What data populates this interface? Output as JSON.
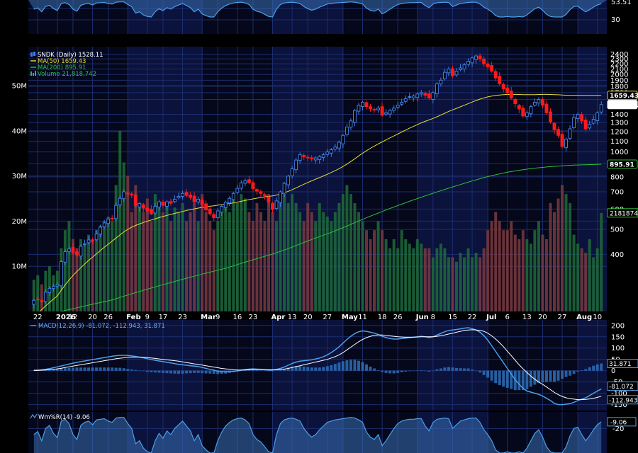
{
  "chart_data": {
    "type": "candlestick",
    "symbol": "SNDK (Daily)",
    "last_price": "1528.11",
    "colors": {
      "up": "#3f7fe8",
      "down": "#ff1a1a",
      "ma50": "#e6dc3a",
      "ma200": "#2dbd3a",
      "volume_up": "#1f6a3a",
      "volume_down": "#7a3a40",
      "grid": "#1c2e6e",
      "macd": "#4a9fe8",
      "signal": "#ffffff",
      "willr": "#4a9fe8"
    },
    "legend": [
      {
        "icon": "candle-icon",
        "text": "SNDK (Daily) 1528.11",
        "color": "#ffffff"
      },
      {
        "icon": "line-icon",
        "text": "MA(50) 1659.43",
        "color": "#e6dc3a"
      },
      {
        "icon": "line-icon",
        "text": "MA(200) 895.91",
        "color": "#2dbd3a"
      },
      {
        "icon": "bar-icon",
        "text": "Volume 21,818,742",
        "color": "#2dbd3a"
      }
    ],
    "x_ticks": [
      "22",
      "2026",
      "12",
      "20",
      "26",
      "Feb",
      "9",
      "17",
      "23",
      "Mar",
      "9",
      "16",
      "23",
      "Apr",
      "13",
      "20",
      "27",
      "May",
      "11",
      "18",
      "26",
      "Jun",
      "8",
      "15",
      "22",
      "Jul",
      "6",
      "13",
      "20",
      "27",
      "Aug",
      "10"
    ],
    "price_axis": {
      "scale": "log",
      "ylim": [
        240,
        2500
      ],
      "ticks": [
        "2400",
        "2300",
        "2200",
        "2100",
        "2000",
        "1900",
        "1800",
        "1700",
        "1600",
        "1400",
        "1300",
        "1200",
        "1100",
        "1000",
        "900",
        "800",
        "700",
        "600",
        "500",
        "400"
      ],
      "tick_values": [
        2400,
        2300,
        2200,
        2100,
        2000,
        1900,
        1800,
        1700,
        1600,
        1400,
        1300,
        1200,
        1100,
        1000,
        900,
        800,
        700,
        600,
        500,
        400
      ],
      "tags": [
        {
          "text": "1659.43",
          "value": 1659.43,
          "fill": "#000000",
          "color": "#ffffff",
          "stroke": "#e6dc3a"
        },
        {
          "text": "1528.11",
          "value": 1528.11,
          "fill": "#ffffff",
          "color": "#000000",
          "stroke": "#ffffff"
        },
        {
          "text": "895.91",
          "value": 895.91,
          "fill": "#000000",
          "color": "#ffffff",
          "stroke": "#2dbd3a"
        }
      ]
    },
    "volume_axis": {
      "ylim": [
        0,
        58000000
      ],
      "ticks": [
        "50M",
        "40M",
        "30M",
        "20M",
        "10M"
      ],
      "tick_values": [
        50000000,
        40000000,
        30000000,
        20000000,
        10000000
      ],
      "tag": {
        "text": "21818742",
        "value": 21818742
      }
    },
    "top_panel": {
      "ticks": [
        "53.51",
        "30"
      ]
    },
    "macd": {
      "label": "MACD(12,26,9) -81.072, -112.943, 31.871",
      "ylim": [
        -170,
        215
      ],
      "ticks": [
        "200",
        "150",
        "100",
        "50",
        "0",
        "-50",
        "-100",
        "-150"
      ],
      "tick_values": [
        200,
        150,
        100,
        50,
        0,
        -50,
        -100,
        -150
      ],
      "tags": [
        {
          "text": "31.871",
          "value": 31.871
        },
        {
          "text": "-81.072",
          "value": -81.072
        },
        {
          "text": "-112.943",
          "value": -112.943
        }
      ]
    },
    "willr": {
      "label": "Wm%R(14) -9.06",
      "ylim": [
        -60,
        0
      ],
      "ticks": [
        "-20"
      ],
      "tick_values": [
        -20
      ],
      "tag": {
        "text": "-9.06",
        "value": -9.06
      }
    },
    "closes": [
      265,
      268,
      262,
      285,
      295,
      300,
      305,
      375,
      410,
      420,
      405,
      398,
      430,
      440,
      455,
      450,
      480,
      510,
      530,
      548,
      550,
      620,
      660,
      700,
      690,
      680,
      620,
      630,
      605,
      590,
      575,
      615,
      640,
      620,
      640,
      632,
      655,
      672,
      690,
      678,
      665,
      640,
      655,
      625,
      595,
      575,
      555,
      590,
      615,
      638,
      660,
      690,
      722,
      758,
      772,
      760,
      720,
      705,
      690,
      675,
      640,
      598,
      645,
      700,
      755,
      805,
      860,
      930,
      975,
      958,
      948,
      940,
      948,
      960,
      975,
      1000,
      1020,
      1045,
      1090,
      1160,
      1250,
      1320,
      1450,
      1520,
      1560,
      1500,
      1470,
      1460,
      1480,
      1390,
      1420,
      1450,
      1480,
      1520,
      1560,
      1610,
      1640,
      1650,
      1680,
      1700,
      1660,
      1620,
      1700,
      1840,
      1900,
      2040,
      2100,
      1980,
      2060,
      2120,
      2180,
      2250,
      2320,
      2360,
      2300,
      2200,
      2140,
      2060,
      1940,
      1840,
      1760,
      1700,
      1620,
      1540,
      1470,
      1380,
      1420,
      1500,
      1560,
      1600,
      1520,
      1420,
      1310,
      1220,
      1160,
      1050,
      1120,
      1230,
      1360,
      1400,
      1320,
      1230,
      1280,
      1340,
      1420,
      1528
    ],
    "ma50": [
      228,
      236,
      244,
      252,
      260,
      268,
      276,
      290,
      304,
      318,
      331,
      343,
      355,
      367,
      379,
      390,
      402,
      414,
      426,
      438,
      450,
      463,
      476,
      489,
      500,
      510,
      518,
      525,
      532,
      538,
      544,
      550,
      556,
      561,
      567,
      572,
      577,
      582,
      587,
      592,
      597,
      601,
      605,
      609,
      612,
      615,
      618,
      621,
      624,
      627,
      630,
      634,
      638,
      643,
      648,
      653,
      657,
      661,
      665,
      669,
      672,
      675,
      680,
      686,
      694,
      703,
      713,
      725,
      737,
      749,
      761,
      772,
      784,
      795,
      807,
      819,
      832,
      846,
      861,
      878,
      897,
      918,
      941,
      965,
      989,
      1011,
      1033,
      1054,
      1075,
      1094,
      1114,
      1134,
      1154,
      1174,
      1195,
      1216,
      1237,
      1257,
      1277,
      1297,
      1315,
      1332,
      1350,
      1370,
      1391,
      1414,
      1437,
      1457,
      1477,
      1498,
      1519,
      1541,
      1563,
      1585,
      1605,
      1622,
      1637,
      1649,
      1658,
      1665,
      1669,
      1672,
      1673,
      1673,
      1672,
      1670,
      1669,
      1669,
      1670,
      1672,
      1673,
      1673,
      1672,
      1670,
      1668,
      1664,
      1662,
      1661,
      1661,
      1661,
      1660,
      1659,
      1659,
      1659,
      1659,
      1659
    ],
    "ma200": [
      232,
      233,
      234,
      235,
      236,
      237,
      238,
      240,
      242,
      244,
      246,
      248,
      250,
      252,
      254,
      256,
      258,
      260,
      262,
      264,
      266,
      269,
      272,
      275,
      278,
      281,
      284,
      287,
      290,
      293,
      296,
      299,
      302,
      305,
      308,
      311,
      314,
      317,
      320,
      323,
      326,
      329,
      332,
      335,
      338,
      341,
      344,
      347,
      350,
      353,
      357,
      361,
      365,
      369,
      373,
      377,
      381,
      385,
      389,
      393,
      397,
      401,
      406,
      411,
      416,
      421,
      427,
      433,
      439,
      445,
      451,
      457,
      463,
      469,
      475,
      481,
      487,
      494,
      501,
      508,
      515,
      523,
      531,
      539,
      547,
      555,
      563,
      571,
      579,
      587,
      595,
      603,
      611,
      619,
      627,
      635,
      643,
      651,
      659,
      667,
      675,
      683,
      691,
      699,
      707,
      715,
      723,
      731,
      739,
      747,
      755,
      763,
      771,
      779,
      787,
      795,
      802,
      809,
      816,
      822,
      828,
      834,
      839,
      844,
      849,
      853,
      857,
      861,
      865,
      868,
      871,
      874,
      877,
      879,
      881,
      883,
      885,
      887,
      889,
      890,
      891,
      892,
      893,
      894,
      895,
      896
    ],
    "macd_line": [
      2,
      3,
      4,
      6,
      9,
      13,
      17,
      21,
      25,
      29,
      33,
      37,
      40,
      43,
      46,
      49,
      52,
      55,
      58,
      61,
      64,
      66,
      68,
      68,
      67,
      65,
      63,
      60,
      57,
      53,
      49,
      46,
      43,
      40,
      37,
      34,
      31,
      28,
      26,
      24,
      22,
      20,
      18,
      14,
      10,
      6,
      2,
      -2,
      -4,
      -5,
      -4,
      -3,
      -1,
      2,
      5,
      7,
      8,
      7,
      6,
      4,
      2,
      2,
      6,
      10,
      16,
      24,
      32,
      38,
      42,
      44,
      46,
      48,
      52,
      56,
      62,
      70,
      80,
      92,
      106,
      122,
      138,
      152,
      164,
      172,
      176,
      174,
      170,
      166,
      160,
      152,
      146,
      142,
      140,
      140,
      142,
      144,
      146,
      148,
      150,
      152,
      150,
      146,
      150,
      158,
      165,
      172,
      178,
      180,
      182,
      185,
      188,
      190,
      186,
      180,
      170,
      155,
      135,
      110,
      85,
      60,
      35,
      10,
      -15,
      -40,
      -60,
      -78,
      -90,
      -95,
      -100,
      -105,
      -112,
      -122,
      -132,
      -145,
      -150,
      -150,
      -148,
      -146,
      -140,
      -132,
      -126,
      -120,
      -110,
      -100,
      -90,
      -81
    ],
    "signal_line": [
      1,
      1,
      2,
      3,
      4,
      6,
      8,
      11,
      14,
      17,
      20,
      23,
      26,
      29,
      32,
      35,
      38,
      41,
      44,
      47,
      50,
      53,
      55,
      57,
      59,
      60,
      60,
      60,
      59,
      58,
      56,
      54,
      52,
      50,
      48,
      46,
      44,
      42,
      39,
      36,
      33,
      30,
      28,
      25,
      22,
      19,
      16,
      13,
      10,
      8,
      6,
      4,
      3,
      3,
      3,
      4,
      5,
      5,
      5,
      5,
      4,
      4,
      4,
      5,
      7,
      10,
      14,
      18,
      22,
      26,
      30,
      34,
      38,
      42,
      46,
      50,
      56,
      62,
      70,
      80,
      92,
      104,
      116,
      128,
      138,
      146,
      152,
      156,
      158,
      158,
      156,
      154,
      152,
      150,
      149,
      148,
      148,
      148,
      149,
      150,
      150,
      150,
      150,
      152,
      155,
      158,
      162,
      166,
      170,
      174,
      178,
      180,
      181,
      180,
      178,
      174,
      166,
      154,
      140,
      124,
      106,
      86,
      66,
      46,
      26,
      8,
      -8,
      -24,
      -38,
      -50,
      -60,
      -72,
      -84,
      -96,
      -106,
      -114,
      -120,
      -124,
      -126,
      -128,
      -128,
      -127,
      -125,
      -122,
      -118,
      -113
    ],
    "willr_line": [
      -30,
      -25,
      -40,
      -20,
      -15,
      -28,
      -35,
      -8,
      -5,
      -12,
      -30,
      -38,
      -15,
      -10,
      -8,
      -14,
      -6,
      -5,
      -4,
      -8,
      -10,
      -3,
      -2,
      -2,
      -12,
      -20,
      -45,
      -40,
      -52,
      -58,
      -60,
      -40,
      -28,
      -36,
      -24,
      -30,
      -20,
      -14,
      -8,
      -16,
      -24,
      -40,
      -30,
      -48,
      -55,
      -60,
      -60,
      -40,
      -26,
      -16,
      -10,
      -6,
      -4,
      -3,
      -6,
      -12,
      -30,
      -38,
      -42,
      -50,
      -58,
      -60,
      -30,
      -12,
      -6,
      -4,
      -3,
      -5,
      -8,
      -20,
      -28,
      -34,
      -30,
      -22,
      -16,
      -10,
      -8,
      -6,
      -5,
      -4,
      -3,
      -2,
      -3,
      -6,
      -10,
      -26,
      -34,
      -38,
      -30,
      -48,
      -40,
      -30,
      -20,
      -12,
      -8,
      -6,
      -5,
      -5,
      -4,
      -4,
      -16,
      -24,
      -10,
      -5,
      -4,
      -3,
      -4,
      -20,
      -14,
      -8,
      -6,
      -4,
      -3,
      -3,
      -10,
      -22,
      -30,
      -40,
      -55,
      -60,
      -60,
      -58,
      -60,
      -60,
      -58,
      -60,
      -52,
      -40,
      -28,
      -22,
      -34,
      -50,
      -58,
      -60,
      -60,
      -60,
      -50,
      -32,
      -20,
      -18,
      -30,
      -40,
      -32,
      -22,
      -14,
      -9.06
    ],
    "volume": [
      7,
      8,
      6,
      9,
      10,
      8,
      9,
      14,
      18,
      20,
      16,
      14,
      16,
      15,
      17,
      16,
      18,
      19,
      20,
      21,
      20,
      28,
      40,
      33,
      30,
      22,
      28,
      24,
      22,
      25,
      20,
      26,
      23,
      22,
      24,
      20,
      23,
      22,
      24,
      20,
      22,
      24,
      20,
      26,
      22,
      20,
      18,
      20,
      22,
      24,
      22,
      25,
      24,
      26,
      25,
      22,
      20,
      24,
      22,
      20,
      26,
      22,
      20,
      24,
      26,
      24,
      26,
      24,
      22,
      20,
      24,
      22,
      20,
      24,
      22,
      21,
      20,
      22,
      24,
      26,
      28,
      26,
      24,
      22,
      20,
      18,
      16,
      18,
      20,
      18,
      16,
      14,
      16,
      14,
      18,
      16,
      15,
      14,
      16,
      15,
      14,
      14,
      12,
      14,
      15,
      14,
      12,
      12,
      11,
      13,
      12,
      14,
      12,
      13,
      12,
      14,
      18,
      20,
      22,
      20,
      18,
      18,
      20,
      17,
      16,
      18,
      16,
      15,
      18,
      20,
      17,
      16,
      24,
      22,
      25,
      28,
      26,
      24,
      17,
      15,
      14,
      13,
      16,
      12,
      14,
      21.8
    ]
  }
}
